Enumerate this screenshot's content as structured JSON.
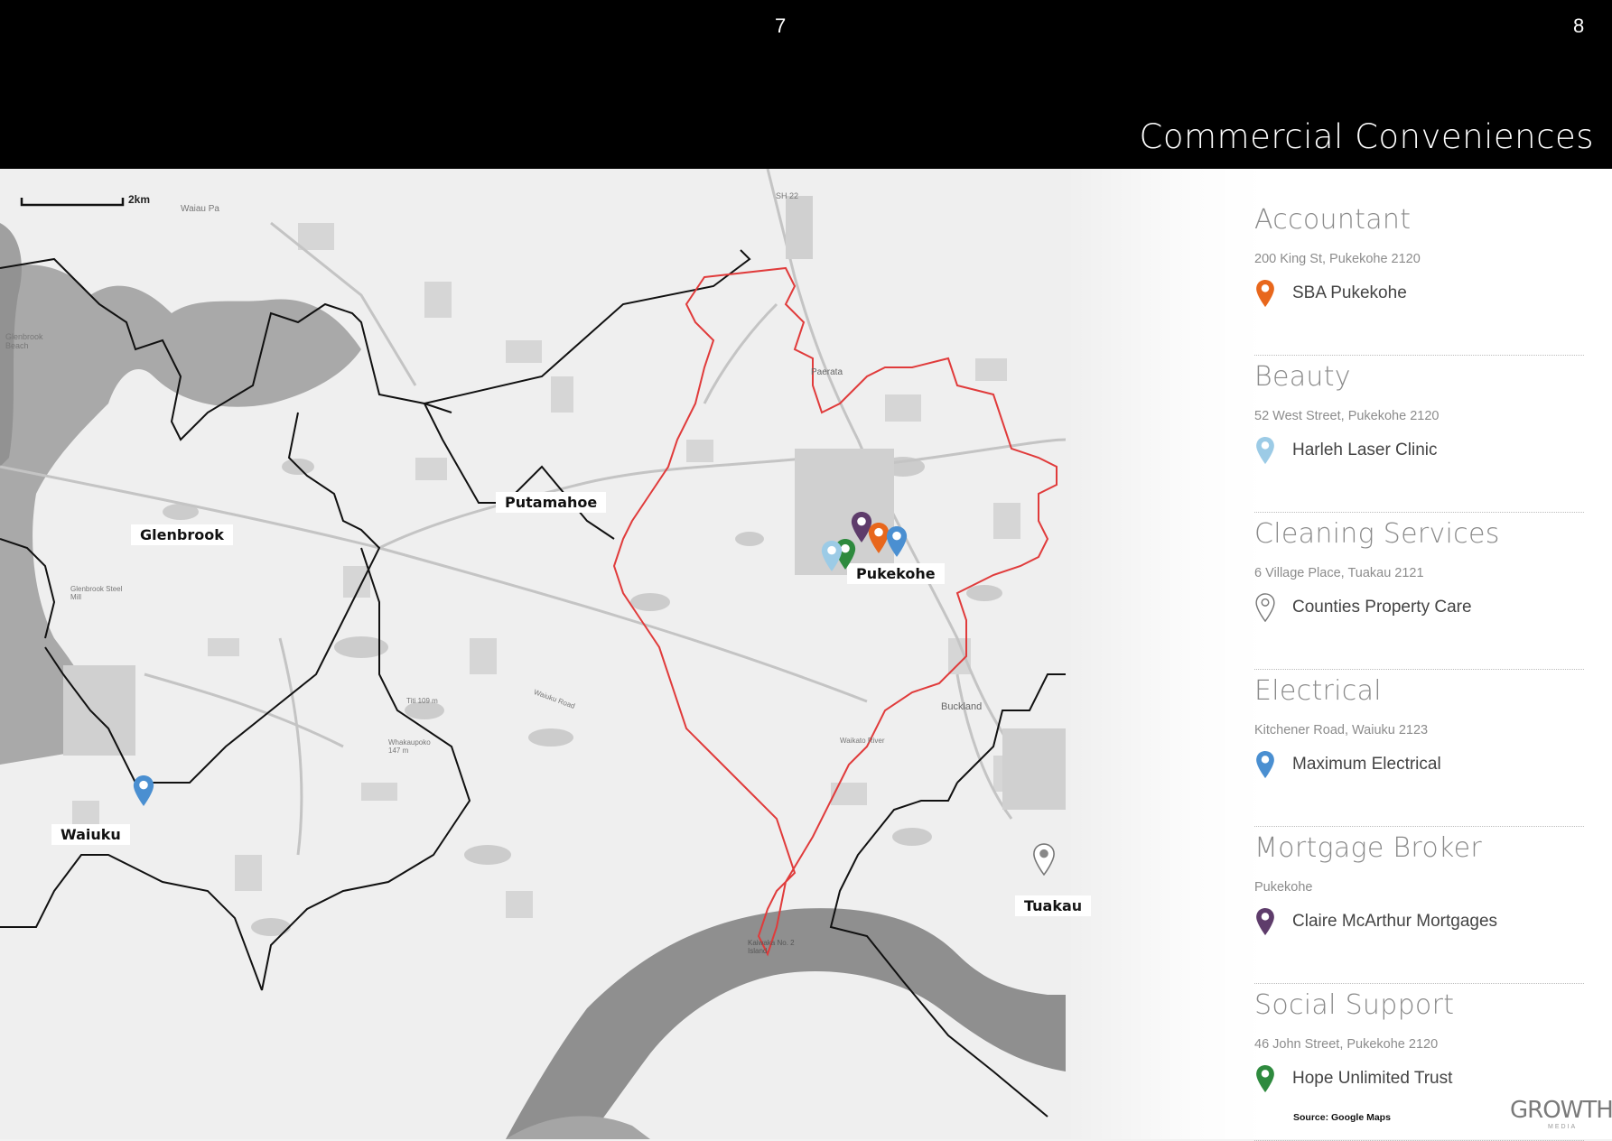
{
  "header": {
    "page_left": "7",
    "page_right": "8",
    "title": "Commercial Conveniences"
  },
  "map": {
    "scale_label": "2km",
    "places": {
      "glenbrook": "Glenbrook",
      "putamahoe": "Putamahoe",
      "pukekohe": "Pukekohe",
      "waiuku": "Waiuku",
      "tuakau": "Tuakau"
    },
    "minor_labels": {
      "waiau_pa": "Waiau Pa",
      "sh22": "SH 22",
      "paerata": "Paerata",
      "buckland": "Buckland",
      "glenbrook_beach": "Glenbrook Beach",
      "glenbrook_steel_mill": "Glenbrook Steel Mill",
      "titi": "Titi 109 m",
      "whakaupoko": "Whakaupoko 147 m",
      "kaiwaka": "Kaiwaka No. 2 Island",
      "waiuku_road": "Waiuku Road",
      "waikato_river": "Waikato River"
    }
  },
  "categories": [
    {
      "title": "Accountant",
      "address": "200 King St, Pukekohe 2120",
      "name": "SBA Pukekohe",
      "pin_color": "#e8671c",
      "pin_style": "solid"
    },
    {
      "title": "Beauty",
      "address": "52 West Street, Pukekohe 2120",
      "name": "Harleh Laser Clinic",
      "pin_color": "#9ccbe6",
      "pin_style": "solid"
    },
    {
      "title": "Cleaning Services",
      "address": "6 Village Place, Tuakau 2121",
      "name": "Counties Property Care",
      "pin_color": "#777777",
      "pin_style": "outline"
    },
    {
      "title": "Electrical",
      "address": "Kitchener Road, Waiuku 2123",
      "name": "Maximum Electrical",
      "pin_color": "#4a8fd1",
      "pin_style": "solid"
    },
    {
      "title": "Mortgage Broker",
      "address": "Pukekohe",
      "name": "Claire McArthur Mortgages",
      "pin_color": "#5e3c6b",
      "pin_style": "solid"
    },
    {
      "title": "Social Support",
      "address": "46 John Street, Pukekohe 2120",
      "name": "Hope Unlimited Trust",
      "pin_color": "#2e8a3e",
      "pin_style": "solid"
    }
  ],
  "footer": {
    "source": "Source:  Google Maps",
    "brand": "GROWTH",
    "brand_sub": "MEDIA"
  }
}
